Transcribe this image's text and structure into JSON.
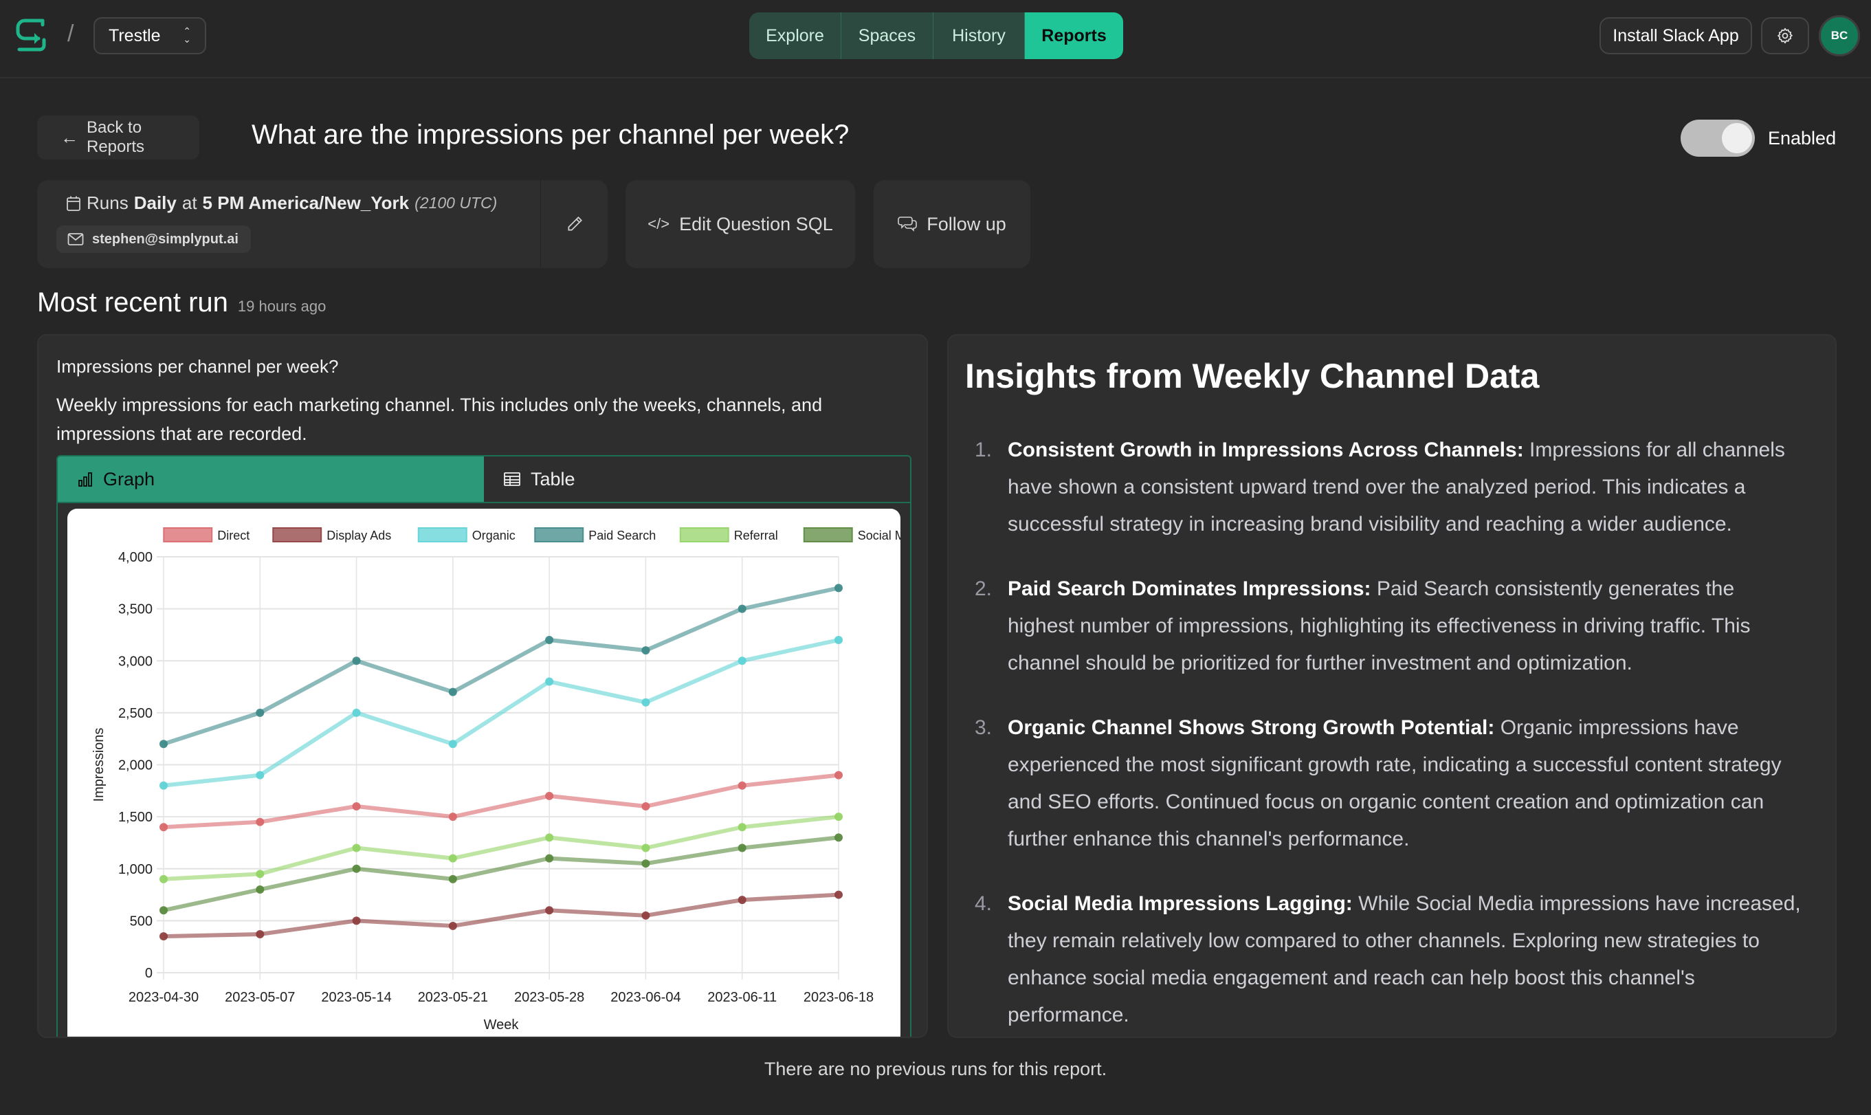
{
  "topbar": {
    "logo": "simplyput-logo-icon",
    "workspace": "Trestle",
    "nav_tabs": [
      {
        "label": "Explore",
        "active": false
      },
      {
        "label": "Spaces",
        "active": false
      },
      {
        "label": "History",
        "active": false
      },
      {
        "label": "Reports",
        "active": true
      }
    ],
    "install_slack": "Install Slack App",
    "avatar_initials": "BC"
  },
  "header": {
    "back_label": "Back to Reports",
    "title": "What are the impressions per channel per week?",
    "toggle_label": "Enabled",
    "toggle_on": true
  },
  "schedule": {
    "prefix": "Runs",
    "frequency": "Daily",
    "at": "at",
    "time": "5 PM America/New_York",
    "utc": "(2100 UTC)",
    "email": "stephen@simplyput.ai"
  },
  "actions": {
    "edit_sql": "Edit Question SQL",
    "follow_up": "Follow up"
  },
  "recent": {
    "heading": "Most recent run",
    "ago": "19 hours ago"
  },
  "result": {
    "question": "Impressions per channel per week?",
    "description": "Weekly impressions for each marketing channel. This includes only the weeks, channels, and impressions that are recorded.",
    "tabs": {
      "graph": "Graph",
      "table": "Table"
    }
  },
  "chart_data": {
    "type": "line",
    "title": "",
    "xlabel": "Week",
    "ylabel": "Impressions",
    "ylim": [
      0,
      4000
    ],
    "yticks": [
      0,
      500,
      1000,
      1500,
      2000,
      2500,
      3000,
      3500,
      4000
    ],
    "ytick_labels": [
      "0",
      "500",
      "1,000",
      "1,500",
      "2,000",
      "2,500",
      "3,000",
      "3,500",
      "4,000"
    ],
    "grid": true,
    "legend_position": "top",
    "categories": [
      "2023-04-30",
      "2023-05-07",
      "2023-05-14",
      "2023-05-21",
      "2023-05-28",
      "2023-06-04",
      "2023-06-11",
      "2023-06-18"
    ],
    "series": [
      {
        "name": "Direct",
        "color": "#d9686b",
        "values": [
          1400,
          1450,
          1600,
          1500,
          1700,
          1600,
          1800,
          1900
        ]
      },
      {
        "name": "Display Ads",
        "color": "#8f3f3f",
        "values": [
          350,
          370,
          500,
          450,
          600,
          550,
          700,
          750
        ]
      },
      {
        "name": "Organic",
        "color": "#5fd3d6",
        "values": [
          1800,
          1900,
          2500,
          2200,
          2800,
          2600,
          3000,
          3200
        ]
      },
      {
        "name": "Paid Search",
        "color": "#3f8a8a",
        "values": [
          2200,
          2500,
          3000,
          2700,
          3200,
          3100,
          3500,
          3700
        ]
      },
      {
        "name": "Referral",
        "color": "#94d466",
        "values": [
          900,
          950,
          1200,
          1100,
          1300,
          1200,
          1400,
          1500
        ]
      },
      {
        "name": "Social Media",
        "color": "#5a8a3e",
        "values": [
          600,
          800,
          1000,
          900,
          1100,
          1050,
          1200,
          1300
        ]
      }
    ]
  },
  "insights": {
    "heading": "Insights from Weekly Channel Data",
    "items": [
      {
        "num": "1.",
        "title": "Consistent Growth in Impressions Across Channels:",
        "text": "Impressions for all channels have shown a consistent upward trend over the analyzed period. This indicates a successful strategy in increasing brand visibility and reaching a wider audience."
      },
      {
        "num": "2.",
        "title": "Paid Search Dominates Impressions:",
        "text": "Paid Search consistently generates the highest number of impressions, highlighting its effectiveness in driving traffic. This channel should be prioritized for further investment and optimization."
      },
      {
        "num": "3.",
        "title": "Organic Channel Shows Strong Growth Potential:",
        "text": "Organic impressions have experienced the most significant growth rate, indicating a successful content strategy and SEO efforts. Continued focus on organic content creation and optimization can further enhance this channel's performance."
      },
      {
        "num": "4.",
        "title": "Social Media Impressions Lagging:",
        "text": "While Social Media impressions have increased, they remain relatively low compared to other channels. Exploring new strategies to enhance social media engagement and reach can help boost this channel's performance."
      }
    ]
  },
  "footer_note": "There are no previous runs for this report.",
  "colors": {
    "accent": "#1fc597",
    "tab_active": "#2c9a78",
    "background": "#262626",
    "card": "#2e2e2e",
    "avatar": "#137a57"
  }
}
